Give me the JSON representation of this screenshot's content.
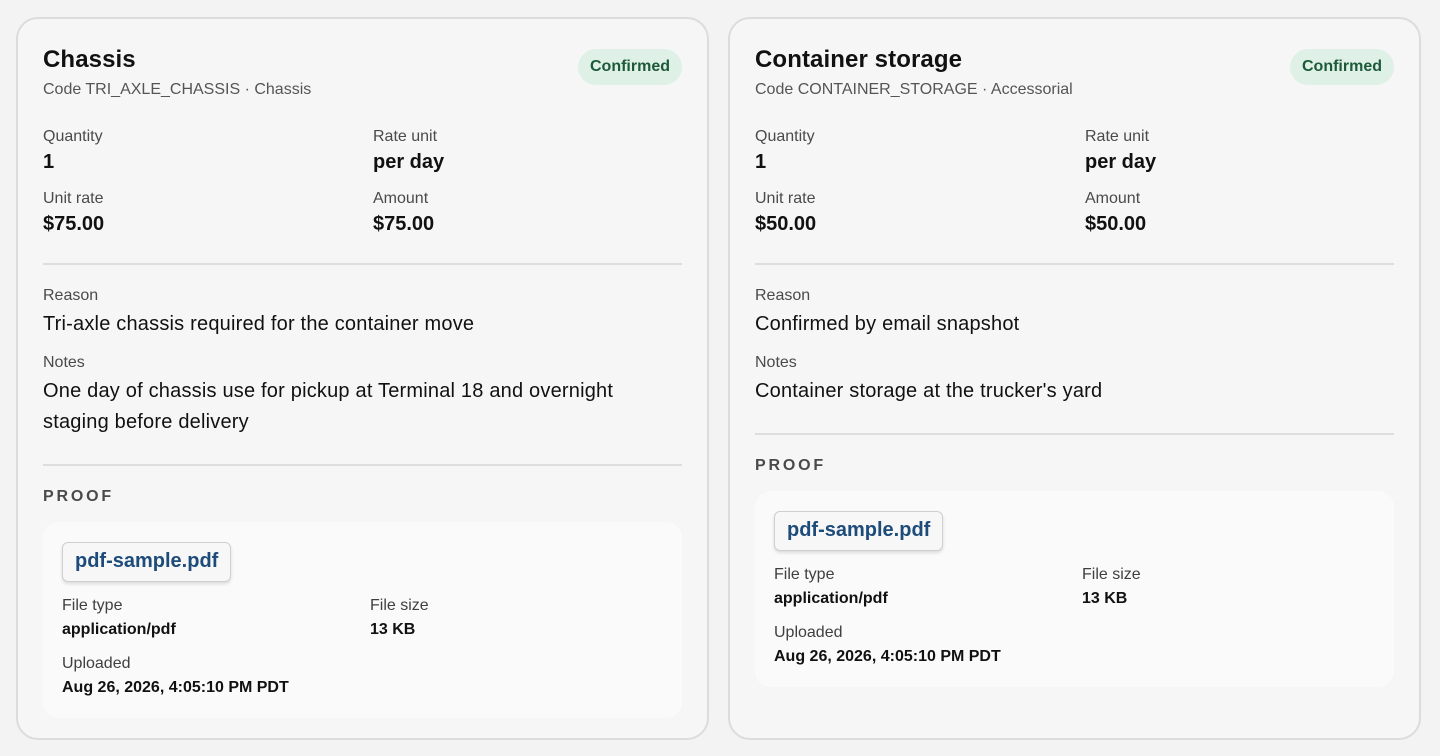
{
  "cards": [
    {
      "title": "Chassis",
      "code": "Code TRI_AXLE_CHASSIS · Chassis",
      "status": "Confirmed",
      "fields": {
        "quantity_label": "Quantity",
        "quantity": "1",
        "rate_unit_label": "Rate unit",
        "rate_unit": "per day",
        "unit_rate_label": "Unit rate",
        "unit_rate": "$75.00",
        "amount_label": "Amount",
        "amount": "$75.00"
      },
      "reason_label": "Reason",
      "reason": "Tri-axle chassis required for the container move",
      "notes_label": "Notes",
      "notes": "One day of chassis use for pickup at Terminal 18 and overnight staging before delivery",
      "proof": {
        "title": "PROOF",
        "file_name": "pdf-sample.pdf",
        "file_type_label": "File type",
        "file_type": "application/pdf",
        "file_size_label": "File size",
        "file_size": "13 KB",
        "uploaded_label": "Uploaded",
        "uploaded": "Aug 26, 2026, 4:05:10 PM PDT"
      }
    },
    {
      "title": "Container storage",
      "code": "Code CONTAINER_STORAGE · Accessorial",
      "status": "Confirmed",
      "fields": {
        "quantity_label": "Quantity",
        "quantity": "1",
        "rate_unit_label": "Rate unit",
        "rate_unit": "per day",
        "unit_rate_label": "Unit rate",
        "unit_rate": "$50.00",
        "amount_label": "Amount",
        "amount": "$50.00"
      },
      "reason_label": "Reason",
      "reason": "Confirmed by email snapshot",
      "notes_label": "Notes",
      "notes": "Container storage at the trucker's yard",
      "proof": {
        "title": "PROOF",
        "file_name": "pdf-sample.pdf",
        "file_type_label": "File type",
        "file_type": "application/pdf",
        "file_size_label": "File size",
        "file_size": "13 KB",
        "uploaded_label": "Uploaded",
        "uploaded": "Aug 26, 2026, 4:05:10 PM PDT"
      }
    }
  ]
}
